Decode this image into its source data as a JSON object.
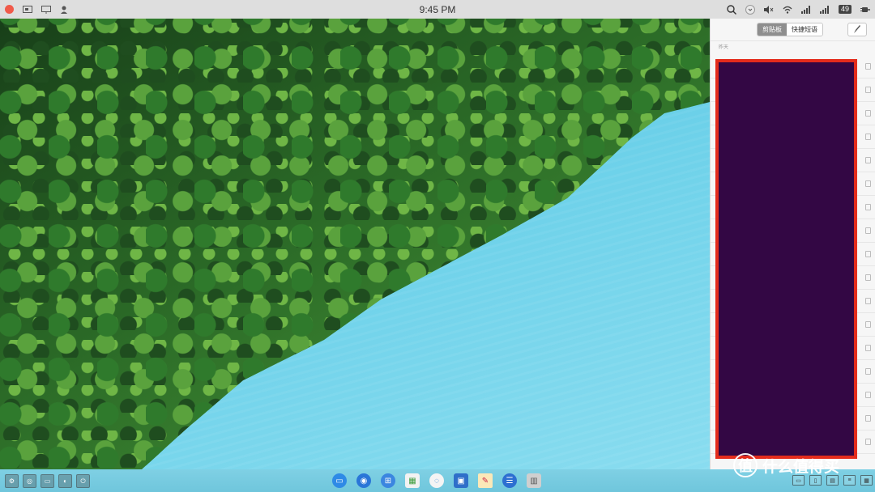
{
  "menubar": {
    "clock": "9:45 PM",
    "battery": "49",
    "left_icons": [
      "record-dot",
      "screen-icon",
      "monitor-icon",
      "user-icon"
    ],
    "right_icons": [
      "search-icon",
      "chevron-icon",
      "mute-icon",
      "wifi-icon",
      "signal-icon",
      "signal-icon",
      "battery-icon",
      "plug-icon"
    ]
  },
  "clipboard_panel": {
    "tabs": [
      {
        "label": "剪贴板",
        "active": true
      },
      {
        "label": "快捷短语",
        "active": false
      }
    ],
    "section_label": "昨天",
    "preview_color": "#330744",
    "highlight_color": "#e32c1c"
  },
  "dock": {
    "apps": [
      "finder-icon",
      "photos-icon",
      "launcher-icon",
      "calendar-icon",
      "browser-icon",
      "store-icon",
      "notes-icon",
      "chat-icon",
      "trash-icon"
    ]
  },
  "watermark": {
    "badge": "值",
    "text": "什么值得买"
  }
}
